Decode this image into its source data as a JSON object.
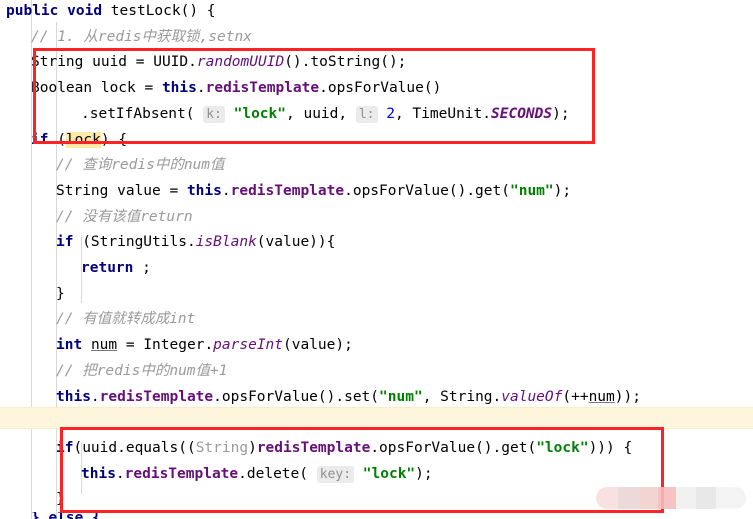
{
  "editor": {
    "language": "java",
    "theme": "intellij-light",
    "background": "#ffffff",
    "accent_annotation_color": "#fb2323",
    "string_color": "#008000",
    "keyword_color": "#000080",
    "comment_color": "#9a9a9a",
    "static_field_color": "#660e7a",
    "caret_row_highlight": "#fdf6dd",
    "search_highlight": "#fbe9a7"
  },
  "code": {
    "lines": [
      {
        "n": 1,
        "indent": 0,
        "tokens": [
          {
            "t": "public",
            "c": "kw"
          },
          {
            "t": " ",
            "c": "plain"
          },
          {
            "t": "void",
            "c": "kw"
          },
          {
            "t": " testLock() {",
            "c": "plain"
          }
        ]
      },
      {
        "n": 2,
        "indent": 1,
        "tokens": [
          {
            "t": "// 1. 从redis中获取锁,setnx",
            "c": "cmt"
          }
        ]
      },
      {
        "n": 3,
        "indent": 1,
        "tokens": [
          {
            "t": "String uuid = UUID.",
            "c": "plain"
          },
          {
            "t": "randomUUID",
            "c": "stat"
          },
          {
            "t": "().toString();",
            "c": "plain"
          }
        ]
      },
      {
        "n": 4,
        "indent": 1,
        "tokens": [
          {
            "t": "Boolean lock = ",
            "c": "plain"
          },
          {
            "t": "this",
            "c": "kw"
          },
          {
            "t": ".",
            "c": "plain"
          },
          {
            "t": "redisTemplate",
            "c": "cls"
          },
          {
            "t": ".opsForValue()",
            "c": "plain"
          }
        ]
      },
      {
        "n": 5,
        "indent": 3,
        "tokens": [
          {
            "t": ".setIfAbsent( ",
            "c": "plain"
          },
          {
            "t": "k:",
            "c": "hint"
          },
          {
            "t": " ",
            "c": "plain"
          },
          {
            "t": "\"lock\"",
            "c": "str"
          },
          {
            "t": ", uuid, ",
            "c": "plain"
          },
          {
            "t": "l:",
            "c": "hint"
          },
          {
            "t": " ",
            "c": "plain"
          },
          {
            "t": "2",
            "c": "num"
          },
          {
            "t": ", TimeUnit.",
            "c": "plain"
          },
          {
            "t": "SECONDS",
            "c": "statb"
          },
          {
            "t": ");",
            "c": "plain"
          }
        ]
      },
      {
        "n": 6,
        "indent": 1,
        "tokens": [
          {
            "t": "if",
            "c": "kw"
          },
          {
            "t": " (",
            "c": "plain"
          },
          {
            "t": "lock",
            "c": "shl"
          },
          {
            "t": ") {",
            "c": "plain"
          }
        ]
      },
      {
        "n": 7,
        "indent": 2,
        "tokens": [
          {
            "t": "// 查询redis中的num值",
            "c": "cmt"
          }
        ]
      },
      {
        "n": 8,
        "indent": 2,
        "tokens": [
          {
            "t": "String value = ",
            "c": "plain"
          },
          {
            "t": "this",
            "c": "kw"
          },
          {
            "t": ".",
            "c": "plain"
          },
          {
            "t": "redisTemplate",
            "c": "cls"
          },
          {
            "t": ".opsForValue().get(",
            "c": "plain"
          },
          {
            "t": "\"num\"",
            "c": "str"
          },
          {
            "t": ");",
            "c": "plain"
          }
        ]
      },
      {
        "n": 9,
        "indent": 2,
        "tokens": [
          {
            "t": "// 没有该值return",
            "c": "cmt"
          }
        ]
      },
      {
        "n": 10,
        "indent": 2,
        "tokens": [
          {
            "t": "if",
            "c": "kw"
          },
          {
            "t": " (StringUtils.",
            "c": "plain"
          },
          {
            "t": "isBlank",
            "c": "stat"
          },
          {
            "t": "(value)){",
            "c": "plain"
          }
        ]
      },
      {
        "n": 11,
        "indent": 3,
        "tokens": [
          {
            "t": "return",
            "c": "kw"
          },
          {
            "t": " ;",
            "c": "plain"
          }
        ]
      },
      {
        "n": 12,
        "indent": 2,
        "tokens": [
          {
            "t": "}",
            "c": "plain"
          }
        ]
      },
      {
        "n": 13,
        "indent": 2,
        "tokens": [
          {
            "t": "// 有值就转成成int",
            "c": "cmt"
          }
        ]
      },
      {
        "n": 14,
        "indent": 2,
        "tokens": [
          {
            "t": "int",
            "c": "kw"
          },
          {
            "t": " ",
            "c": "plain"
          },
          {
            "t": "num",
            "c": "undl"
          },
          {
            "t": " = Integer.",
            "c": "plain"
          },
          {
            "t": "parseInt",
            "c": "stat"
          },
          {
            "t": "(value);",
            "c": "plain"
          }
        ]
      },
      {
        "n": 15,
        "indent": 2,
        "tokens": [
          {
            "t": "// 把redis中的num值+1",
            "c": "cmt"
          }
        ]
      },
      {
        "n": 16,
        "indent": 2,
        "tokens": [
          {
            "t": "this",
            "c": "kw"
          },
          {
            "t": ".",
            "c": "plain"
          },
          {
            "t": "redisTemplate",
            "c": "cls"
          },
          {
            "t": ".opsForValue().set(",
            "c": "plain"
          },
          {
            "t": "\"num\"",
            "c": "str"
          },
          {
            "t": ", String.",
            "c": "plain"
          },
          {
            "t": "valueOf",
            "c": "stat"
          },
          {
            "t": "(++",
            "c": "plain"
          },
          {
            "t": "num",
            "c": "undl"
          },
          {
            "t": "));",
            "c": "plain"
          }
        ]
      },
      {
        "n": 17,
        "indent": 0,
        "highlight": true,
        "tokens": []
      },
      {
        "n": 18,
        "indent": 2,
        "tokens": [
          {
            "t": "if",
            "c": "kw"
          },
          {
            "t": "(uuid.equals((",
            "c": "plain"
          },
          {
            "t": "String",
            "c": "gray"
          },
          {
            "t": ")",
            "c": "plain"
          },
          {
            "t": "redisTemplate",
            "c": "cls"
          },
          {
            "t": ".opsForValue().get(",
            "c": "plain"
          },
          {
            "t": "\"lock\"",
            "c": "str"
          },
          {
            "t": "))) {",
            "c": "plain"
          }
        ]
      },
      {
        "n": 19,
        "indent": 3,
        "tokens": [
          {
            "t": "this",
            "c": "kw"
          },
          {
            "t": ".",
            "c": "plain"
          },
          {
            "t": "redisTemplate",
            "c": "cls"
          },
          {
            "t": ".delete( ",
            "c": "plain"
          },
          {
            "t": "key:",
            "c": "hint"
          },
          {
            "t": " ",
            "c": "plain"
          },
          {
            "t": "\"lock\"",
            "c": "str"
          },
          {
            "t": ");",
            "c": "plain"
          }
        ]
      },
      {
        "n": 20,
        "indent": 2,
        "tokens": [
          {
            "t": "}",
            "c": "plain"
          }
        ]
      },
      {
        "n": 21,
        "indent": 1,
        "clipped": true,
        "tokens": [
          {
            "t": "} else {",
            "c": "kw"
          }
        ]
      }
    ]
  },
  "annotations": {
    "boxes": [
      {
        "id": "redbox-top",
        "label": "acquire-lock-highlight",
        "color": "#fb2323"
      },
      {
        "id": "redbox-bottom",
        "label": "release-lock-highlight",
        "color": "#fb2323"
      }
    ],
    "watermark": {
      "label": "blurred-watermark",
      "text": ""
    }
  }
}
